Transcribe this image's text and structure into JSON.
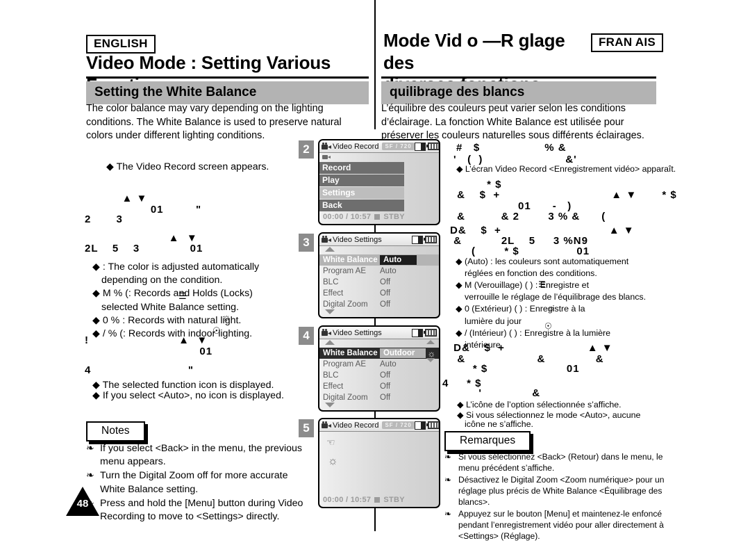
{
  "page_number": "48",
  "left": {
    "language_badge": "ENGLISH",
    "title": "Video Mode : Setting Various Functions",
    "section": "Setting the White Balance",
    "intro": "The color balance may vary depending on the lighting conditions. The White Balance is used to preserve natural colors under different lighting conditions.",
    "step1_result": "◆ The Video Record screen appears.",
    "step2_garbled_line1": "   ▲ ▼",
    "step2_garbled_line2": "           01         \"",
    "step2_garbled_line3": "2       3",
    "step3_garbled_line1": "                ▲  ▼",
    "step3_garbled_line2": "2L    5    3              01",
    "bullets": [
      "◆          : The color is adjusted automatically",
      "depending on the condition.",
      "◆ M   %        (: Records and Holds (Locks)",
      "selected White Balance setting.",
      "◆ 0     %        : Records with natural light.",
      "◆ /    %        (: Records with indoor lighting."
    ],
    "step4_garbled_line1": "!                         ▲  ▼",
    "step4_garbled_line2": "                                01",
    "step4_garbled_line3": "4                           \"",
    "step5_result_1": "◆ The selected function icon is displayed.",
    "step5_result_2": "◆ If you select <Auto>, no icon is displayed.",
    "notes_label": "Notes",
    "notes": [
      "If you select <Back> in the menu, the previous menu appears.",
      "Turn the Digital Zoom off for more accurate White Balance setting.",
      "Press and hold the [Menu] button during Video Recording to move to <Settings> directly."
    ]
  },
  "right": {
    "language_badge": "FRAN  AIS",
    "title_line1": "Mode Vid  o —R  glage des",
    "title_line2": "diverses fonctions",
    "section": " quilibrage des blancs",
    "intro": "L’équilibre des couleurs peut varier selon les conditions d’éclairage. La fonction White Balance est utilisée pour préserver les couleurs naturelles sous différents éclairages.",
    "step1_garbled_1": "#   $                  % &",
    "step1_garbled_2": "'   (  )                       &'",
    "step1_result": "◆ L’écran Video Record <Enregistrement vidéo> apparaît.",
    "step2_garbled_1": "       * $",
    "step2_garbled_2": " &    $  +                               ▲ ▼       * $",
    "step2_garbled_3": "                  01      -   )",
    "step2_garbled_4": " &          & 2        3 % &      (",
    "step3_garbled_1": "D&    $  +                              ▲ ▼",
    "step3_garbled_2": " &           2L    5     3 %N9",
    "step3_garbled_3": "      (        * $                01",
    "bullets": [
      "◆          (Auto) : les couleurs sont automatiquement",
      "réglées en fonction des conditions.",
      "◆ M      (Verouillage) (        ) : Enregistre et",
      "verrouille le réglage de l’équilibrage des blancs.",
      "◆ 0           (Extérieur) (      ) : Enregistre à la",
      "lumière du jour",
      "◆ /            (Intérieur) (      ) : Enregistre à la lumière",
      "intérieure"
    ],
    "step4_garbled_1": " D&    $  +                       ▲ ▼",
    "step4_garbled_2": "  &                    &              &",
    "step4_garbled_3": "     * $                      01",
    "step4_garbled_4": "4     * $",
    "step4_garbled_5": "        '              &",
    "step5_result_1": "◆ L’icône de l’option sélectionnée s’affiche.",
    "step5_result_2": "◆ Si vous sélectionnez le mode <Auto>, aucune",
    "step5_result_3": "icône ne s’affiche.",
    "notes_label": "Remarques",
    "notes": [
      "Si vous sélectionnez <Back> (Retour) dans le menu, le menu précédent s’affiche.",
      "Désactivez le Digital Zoom <Zoom numérique> pour un réglage plus précis de White Balance <Équilibrage des blancs>.",
      "Appuyez sur le bouton [Menu] et maintenez-le enfoncé pendant l’enregistrement vidéo pour aller directement à <Settings> (Réglage)."
    ]
  },
  "screens": [
    {
      "step": "2",
      "title": "Video Record",
      "quality_badge": "SF  /  720",
      "menu_items": [
        {
          "label": "Record",
          "style": "dark"
        },
        {
          "label": "Play",
          "style": "dark"
        },
        {
          "label": "Settings",
          "style": "light"
        },
        {
          "label": "Back",
          "style": "dark"
        }
      ],
      "time": "00:00 / 10:57",
      "status": "STBY"
    },
    {
      "step": "3",
      "title": "Video Settings",
      "rows": [
        {
          "label": "White Balance",
          "value": "Auto",
          "selected": "dark"
        },
        {
          "label": "Program AE",
          "value": "Auto",
          "selected": "none"
        },
        {
          "label": "BLC",
          "value": "Off",
          "selected": "none"
        },
        {
          "label": "Effect",
          "value": "Off",
          "selected": "none"
        },
        {
          "label": "Digital Zoom",
          "value": "Off",
          "selected": "none"
        }
      ]
    },
    {
      "step": "4",
      "title": "Video Settings",
      "rows": [
        {
          "label": "White Balance",
          "value": "Outdoor",
          "selected": "black"
        },
        {
          "label": "Program AE",
          "value": "Auto",
          "selected": "none"
        },
        {
          "label": "BLC",
          "value": "Off",
          "selected": "none"
        },
        {
          "label": "Effect",
          "value": "Off",
          "selected": "none"
        },
        {
          "label": "Digital Zoom",
          "value": "Off",
          "selected": "none"
        }
      ]
    },
    {
      "step": "5",
      "title": "Video Record",
      "quality_badge": "SF  /  720",
      "time": "00:00 / 10:57",
      "status": "STBY"
    }
  ],
  "colors": {
    "section_bar": "#b3b3b3",
    "step_badge": "#8c8c8c",
    "menu_dark": "#6e6e6e",
    "menu_light": "#bdbdbd",
    "selected_black": "#1d1d1d"
  }
}
